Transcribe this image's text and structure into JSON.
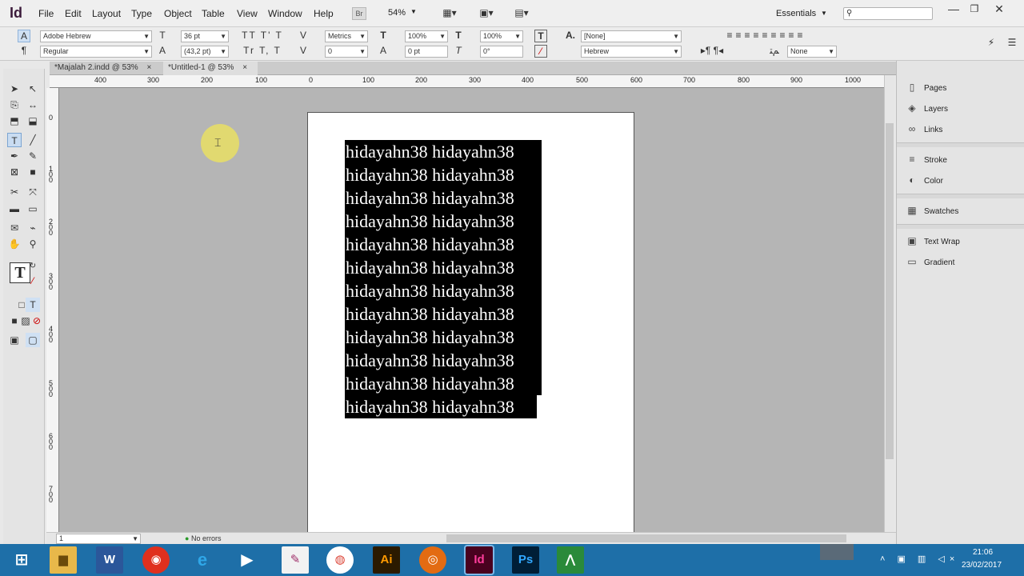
{
  "app": {
    "logo": "Id"
  },
  "menu": [
    "File",
    "Edit",
    "Layout",
    "Type",
    "Object",
    "Table",
    "View",
    "Window",
    "Help"
  ],
  "menubar": {
    "bridge_label": "Br",
    "zoom": "54%",
    "workspace": "Essentials",
    "search_placeholder": ""
  },
  "control_panel": {
    "font_family": "Adobe Hebrew",
    "font_style": "Regular",
    "font_size": "36 pt",
    "leading": "(43,2 pt)",
    "kerning": "Metrics",
    "tracking": "0",
    "vscale": "100%",
    "hscale": "100%",
    "baseline": "0 pt",
    "skew": "0°",
    "char_style": "[None]",
    "language": "Hebrew",
    "none_select": "None"
  },
  "tabs": [
    {
      "label": "*Majalah 2.indd @ 53%",
      "active": false
    },
    {
      "label": "*Untitled-1 @ 53%",
      "active": true
    }
  ],
  "hruler": {
    "labels": [
      "400",
      "300",
      "200",
      "100",
      "0",
      "100",
      "200",
      "300",
      "400",
      "500",
      "600",
      "700",
      "800",
      "900",
      "1000"
    ]
  },
  "vruler": {
    "labels": [
      "0",
      "1\n0\n0",
      "2\n0\n0",
      "3\n0\n0",
      "4\n0\n0",
      "5\n0\n0",
      "6\n0\n0",
      "7\n0\n0"
    ]
  },
  "document": {
    "lines": [
      "hidayahn38 hidayahn38",
      "hidayahn38 hidayahn38",
      "hidayahn38 hidayahn38",
      "hidayahn38 hidayahn38",
      "hidayahn38 hidayahn38",
      "hidayahn38 hidayahn38",
      "hidayahn38 hidayahn38",
      "hidayahn38 hidayahn38",
      "hidayahn38 hidayahn38",
      "hidayahn38 hidayahn38",
      "hidayahn38 hidayahn38",
      "hidayahn38 hidayahn38"
    ]
  },
  "status": {
    "page": "1",
    "preflight": "No errors"
  },
  "panels": {
    "group1": [
      "Pages",
      "Layers",
      "Links"
    ],
    "group2": [
      "Stroke",
      "Color"
    ],
    "group3": [
      "Swatches"
    ],
    "group4": [
      "Text Wrap",
      "Gradient"
    ]
  },
  "tray": {
    "time": "21:06",
    "date": "23/02/2017"
  },
  "taskbar": {
    "apps": [
      "W",
      "Ai",
      "Id",
      "Ps"
    ]
  }
}
